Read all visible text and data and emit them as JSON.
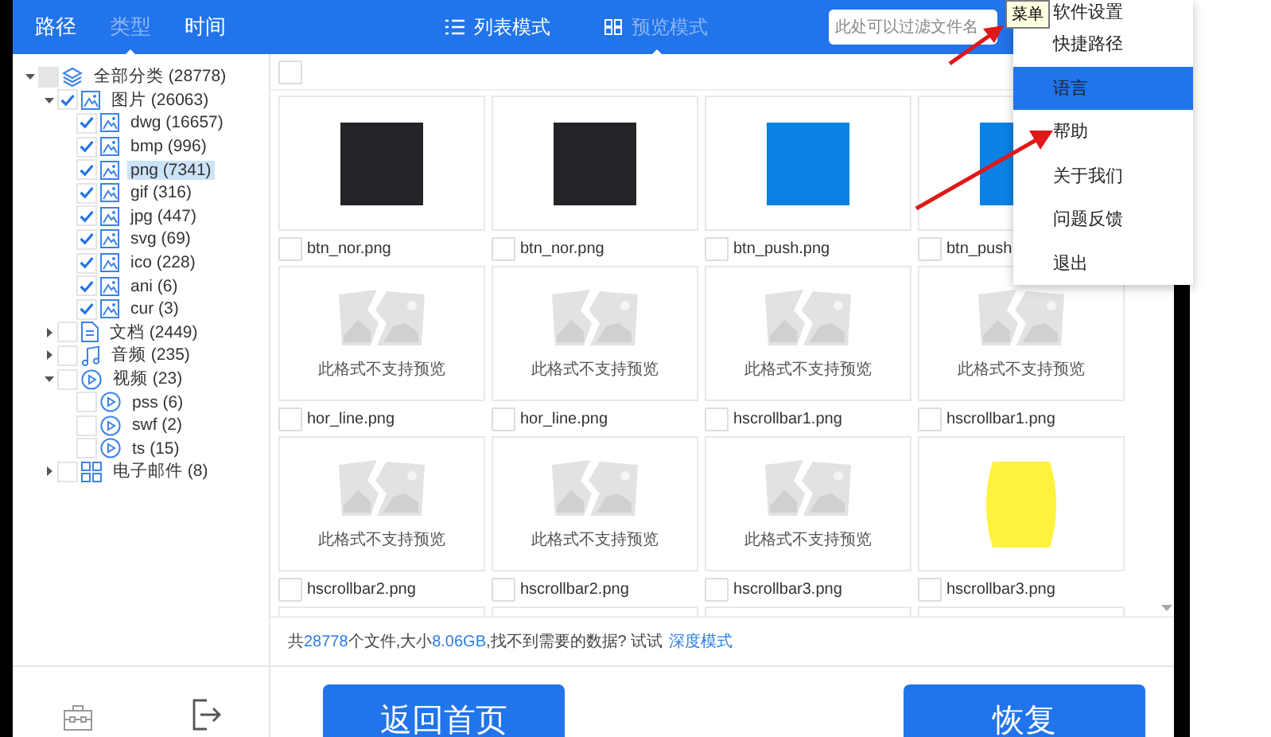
{
  "top_tabs": [
    {
      "label": "路径",
      "selected": false
    },
    {
      "label": "类型",
      "selected": true
    },
    {
      "label": "时间",
      "selected": false
    }
  ],
  "view_modes": [
    {
      "label": "列表模式",
      "kind": "list",
      "selected": false
    },
    {
      "label": "预览模式",
      "kind": "grid",
      "selected": true
    }
  ],
  "search": {
    "placeholder": "此处可以过滤文件名"
  },
  "tooltip": "菜单",
  "menu": [
    {
      "label": "软件设置",
      "selected": false
    },
    {
      "label": "快捷路径",
      "selected": false
    },
    {
      "label": "语言",
      "selected": true
    },
    {
      "label": "帮助",
      "selected": false
    },
    {
      "label": "关于我们",
      "selected": false
    },
    {
      "label": "问题反馈",
      "selected": false
    },
    {
      "label": "退出",
      "selected": false
    }
  ],
  "tree": [
    {
      "label": "全部分类 (28778)",
      "kind": "layers",
      "checked": false,
      "indeterminate": true,
      "expanded": true,
      "selected": false,
      "children": [
        {
          "label": "图片 (26063)",
          "kind": "image",
          "checked": true,
          "indeterminate": false,
          "expanded": true,
          "selected": false,
          "children": [
            {
              "label": "dwg (16657)",
              "kind": "image",
              "checked": true,
              "indeterminate": false,
              "selected": false
            },
            {
              "label": "bmp (996)",
              "kind": "image",
              "checked": true,
              "indeterminate": false,
              "selected": false
            },
            {
              "label": "png (7341)",
              "kind": "image",
              "checked": true,
              "indeterminate": false,
              "selected": true
            },
            {
              "label": "gif (316)",
              "kind": "image",
              "checked": true,
              "indeterminate": false,
              "selected": false
            },
            {
              "label": "jpg (447)",
              "kind": "image",
              "checked": true,
              "indeterminate": false,
              "selected": false
            },
            {
              "label": "svg (69)",
              "kind": "image",
              "checked": true,
              "indeterminate": false,
              "selected": false
            },
            {
              "label": "ico (228)",
              "kind": "image",
              "checked": true,
              "indeterminate": false,
              "selected": false
            },
            {
              "label": "ani (6)",
              "kind": "image",
              "checked": true,
              "indeterminate": false,
              "selected": false
            },
            {
              "label": "cur (3)",
              "kind": "image",
              "checked": true,
              "indeterminate": false,
              "selected": false
            }
          ]
        },
        {
          "label": "文档 (2449)",
          "kind": "document",
          "checked": false,
          "indeterminate": false,
          "expanded": false,
          "selected": false
        },
        {
          "label": "音频 (235)",
          "kind": "music",
          "checked": false,
          "indeterminate": false,
          "expanded": false,
          "selected": false
        },
        {
          "label": "视频 (23)",
          "kind": "video",
          "checked": false,
          "indeterminate": false,
          "expanded": true,
          "selected": false,
          "children": [
            {
              "label": "pss (6)",
              "kind": "video",
              "checked": false,
              "indeterminate": false,
              "selected": false
            },
            {
              "label": "swf (2)",
              "kind": "video",
              "checked": false,
              "indeterminate": false,
              "selected": false
            },
            {
              "label": "ts (15)",
              "kind": "video",
              "checked": false,
              "indeterminate": false,
              "selected": false
            }
          ]
        },
        {
          "label": "电子邮件 (8)",
          "kind": "apps",
          "checked": false,
          "indeterminate": false,
          "expanded": false,
          "selected": false
        }
      ]
    }
  ],
  "select_all": {
    "checked": false
  },
  "files": [
    {
      "name": "btn_nor.png",
      "checked": false,
      "preview": {
        "kind": "swatch",
        "color": "#242428"
      }
    },
    {
      "name": "btn_nor.png",
      "checked": false,
      "preview": {
        "kind": "swatch",
        "color": "#242428"
      }
    },
    {
      "name": "btn_push.png",
      "checked": false,
      "preview": {
        "kind": "swatch",
        "color": "#0a82e4"
      }
    },
    {
      "name": "btn_push",
      "checked": false,
      "preview": {
        "kind": "swatch",
        "color": "#0a82e4"
      }
    },
    {
      "name": "hor_line.png",
      "checked": false,
      "preview": {
        "kind": "unsupported",
        "text": "此格式不支持预览"
      }
    },
    {
      "name": "hor_line.png",
      "checked": false,
      "preview": {
        "kind": "unsupported",
        "text": "此格式不支持预览"
      }
    },
    {
      "name": "hscrollbar1.png",
      "checked": false,
      "preview": {
        "kind": "unsupported",
        "text": "此格式不支持预览"
      }
    },
    {
      "name": "hscrollbar1.png",
      "checked": false,
      "preview": {
        "kind": "unsupported",
        "text": "此格式不支持预览"
      }
    },
    {
      "name": "hscrollbar2.png",
      "checked": false,
      "preview": {
        "kind": "unsupported",
        "text": "此格式不支持预览"
      }
    },
    {
      "name": "hscrollbar2.png",
      "checked": false,
      "preview": {
        "kind": "unsupported",
        "text": "此格式不支持预览"
      }
    },
    {
      "name": "hscrollbar3.png",
      "checked": false,
      "preview": {
        "kind": "unsupported",
        "text": "此格式不支持预览"
      }
    },
    {
      "name": "hscrollbar3.png",
      "checked": false,
      "preview": {
        "kind": "barrel",
        "color": "#fff23c"
      }
    },
    {
      "preview": {
        "kind": "cut"
      }
    },
    {
      "preview": {
        "kind": "cut"
      }
    },
    {
      "preview": {
        "kind": "cut"
      }
    },
    {
      "preview": {
        "kind": "cut"
      }
    }
  ],
  "status": [
    {
      "text": "共",
      "highlight": false
    },
    {
      "text": "28778",
      "highlight": true
    },
    {
      "text": "个文件,大小",
      "highlight": false
    },
    {
      "text": "8.06GB",
      "highlight": true
    },
    {
      "text": ",找不到需要的数据? 试试",
      "highlight": false
    }
  ],
  "status_link": "深度模式",
  "buttons": [
    "返回首页",
    "恢复"
  ]
}
